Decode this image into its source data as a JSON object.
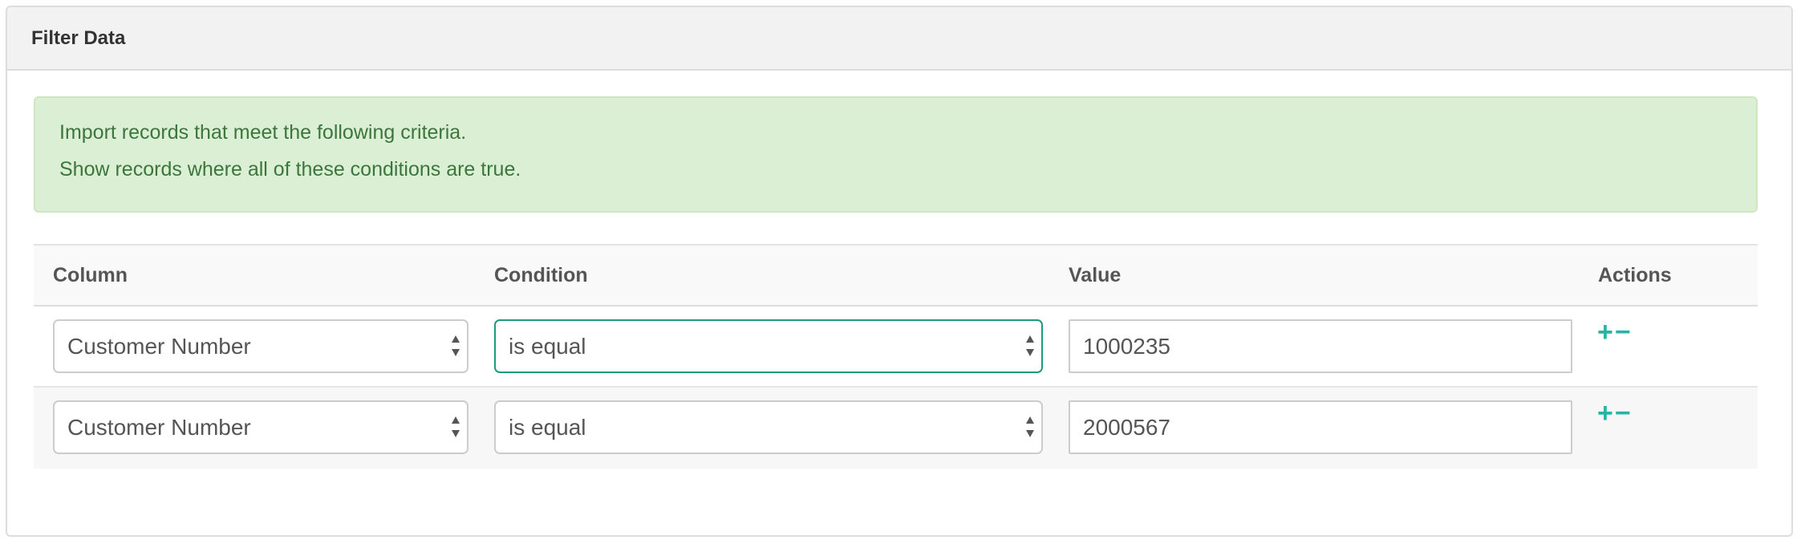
{
  "panel": {
    "title": "Filter Data"
  },
  "alert": {
    "line1": "Import records that meet the following criteria.",
    "line2": "Show records where all of these conditions are true."
  },
  "table": {
    "headers": {
      "column": "Column",
      "condition": "Condition",
      "value": "Value",
      "actions": "Actions"
    },
    "rows": [
      {
        "column": "Customer Number",
        "condition": "is equal",
        "value": "1000235",
        "add": "+",
        "remove": "−"
      },
      {
        "column": "Customer Number",
        "condition": "is equal",
        "value": "2000567",
        "add": "+",
        "remove": "−"
      }
    ]
  },
  "colors": {
    "accent": "#26b5a5",
    "focus": "#1e9a7c",
    "alert_bg": "#dbefd4",
    "alert_text": "#3c763d"
  }
}
